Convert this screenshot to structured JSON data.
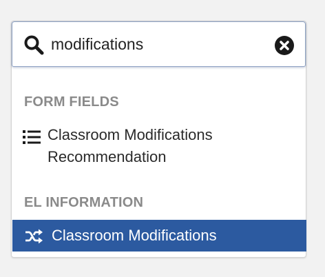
{
  "search": {
    "query": "modifications",
    "icon": "search-icon",
    "clear_icon": "close-circle-icon"
  },
  "sections": [
    {
      "heading": "FORM FIELDS",
      "items": [
        {
          "icon": "list-icon",
          "label_line1": "Classroom Modifications",
          "label_line2": "Recommendation",
          "selected": false
        }
      ]
    },
    {
      "heading": "EL INFORMATION",
      "items": [
        {
          "icon": "shuffle-icon",
          "label_line1": "Classroom Modifications",
          "selected": true
        }
      ]
    }
  ],
  "colors": {
    "selected_bg": "#2c5aa0",
    "heading": "#8a8a8a",
    "background": "#f2f2f2"
  }
}
